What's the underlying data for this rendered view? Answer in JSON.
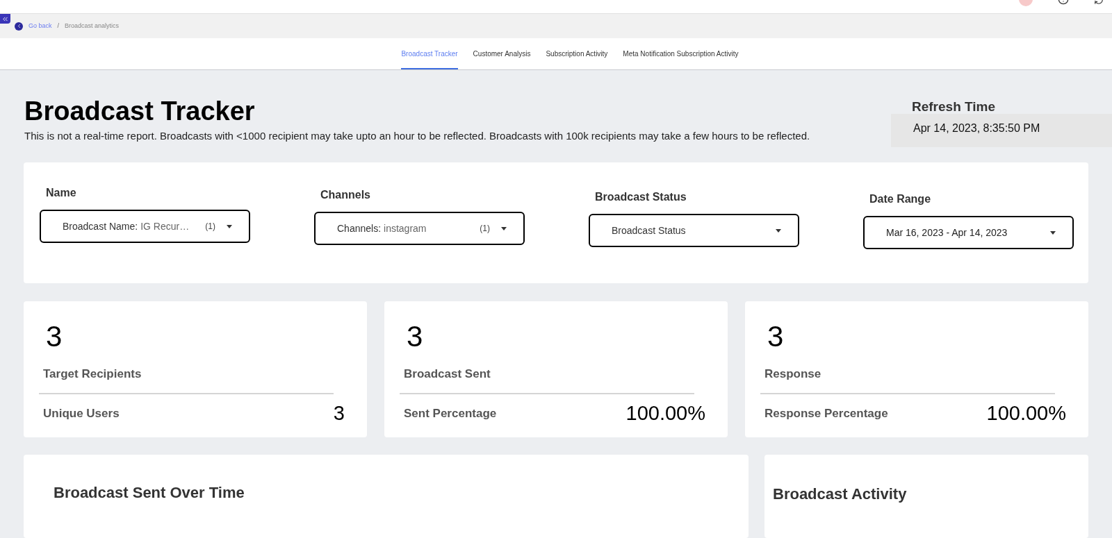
{
  "breadcrumb": {
    "back": "Go back",
    "separator": "/",
    "current": "Broadcast analytics"
  },
  "tabs": [
    {
      "label": "Broadcast Tracker",
      "selected": true
    },
    {
      "label": "Customer Analysis",
      "selected": false
    },
    {
      "label": "Subscription Activity",
      "selected": false
    },
    {
      "label": "Meta Notification Subscription Activity",
      "selected": false
    }
  ],
  "header": {
    "title": "Broadcast Tracker",
    "note": "This is not a real-time report. Broadcasts with <1000 recipient may take upto an hour to be reflected. Broadcasts with 100k recipients may take a few hours to be reflected.",
    "refresh_label": "Refresh Time",
    "refresh_value": "Apr 14, 2023, 8:35:50 PM"
  },
  "filters": [
    {
      "label": "Name",
      "prefix": "Broadcast Name:",
      "value": "IG Recur…",
      "count": "(1)"
    },
    {
      "label": "Channels",
      "prefix": "Channels:",
      "value": "instagram",
      "count": "(1)"
    },
    {
      "label": "Broadcast Status",
      "placeholder": "Broadcast Status"
    },
    {
      "label": "Date Range",
      "value": "Mar 16, 2023 - Apr 14, 2023"
    }
  ],
  "stats": [
    {
      "value": "3",
      "label": "Target Recipients",
      "sub_label": "Unique Users",
      "sub_value": "3"
    },
    {
      "value": "3",
      "label": "Broadcast Sent",
      "sub_label": "Sent Percentage",
      "sub_value": "100.00%"
    },
    {
      "value": "3",
      "label": "Response",
      "sub_label": "Response Percentage",
      "sub_value": "100.00%"
    }
  ],
  "panels": [
    {
      "title": "Broadcast Sent Over Time"
    },
    {
      "title": "Broadcast Activity"
    }
  ]
}
